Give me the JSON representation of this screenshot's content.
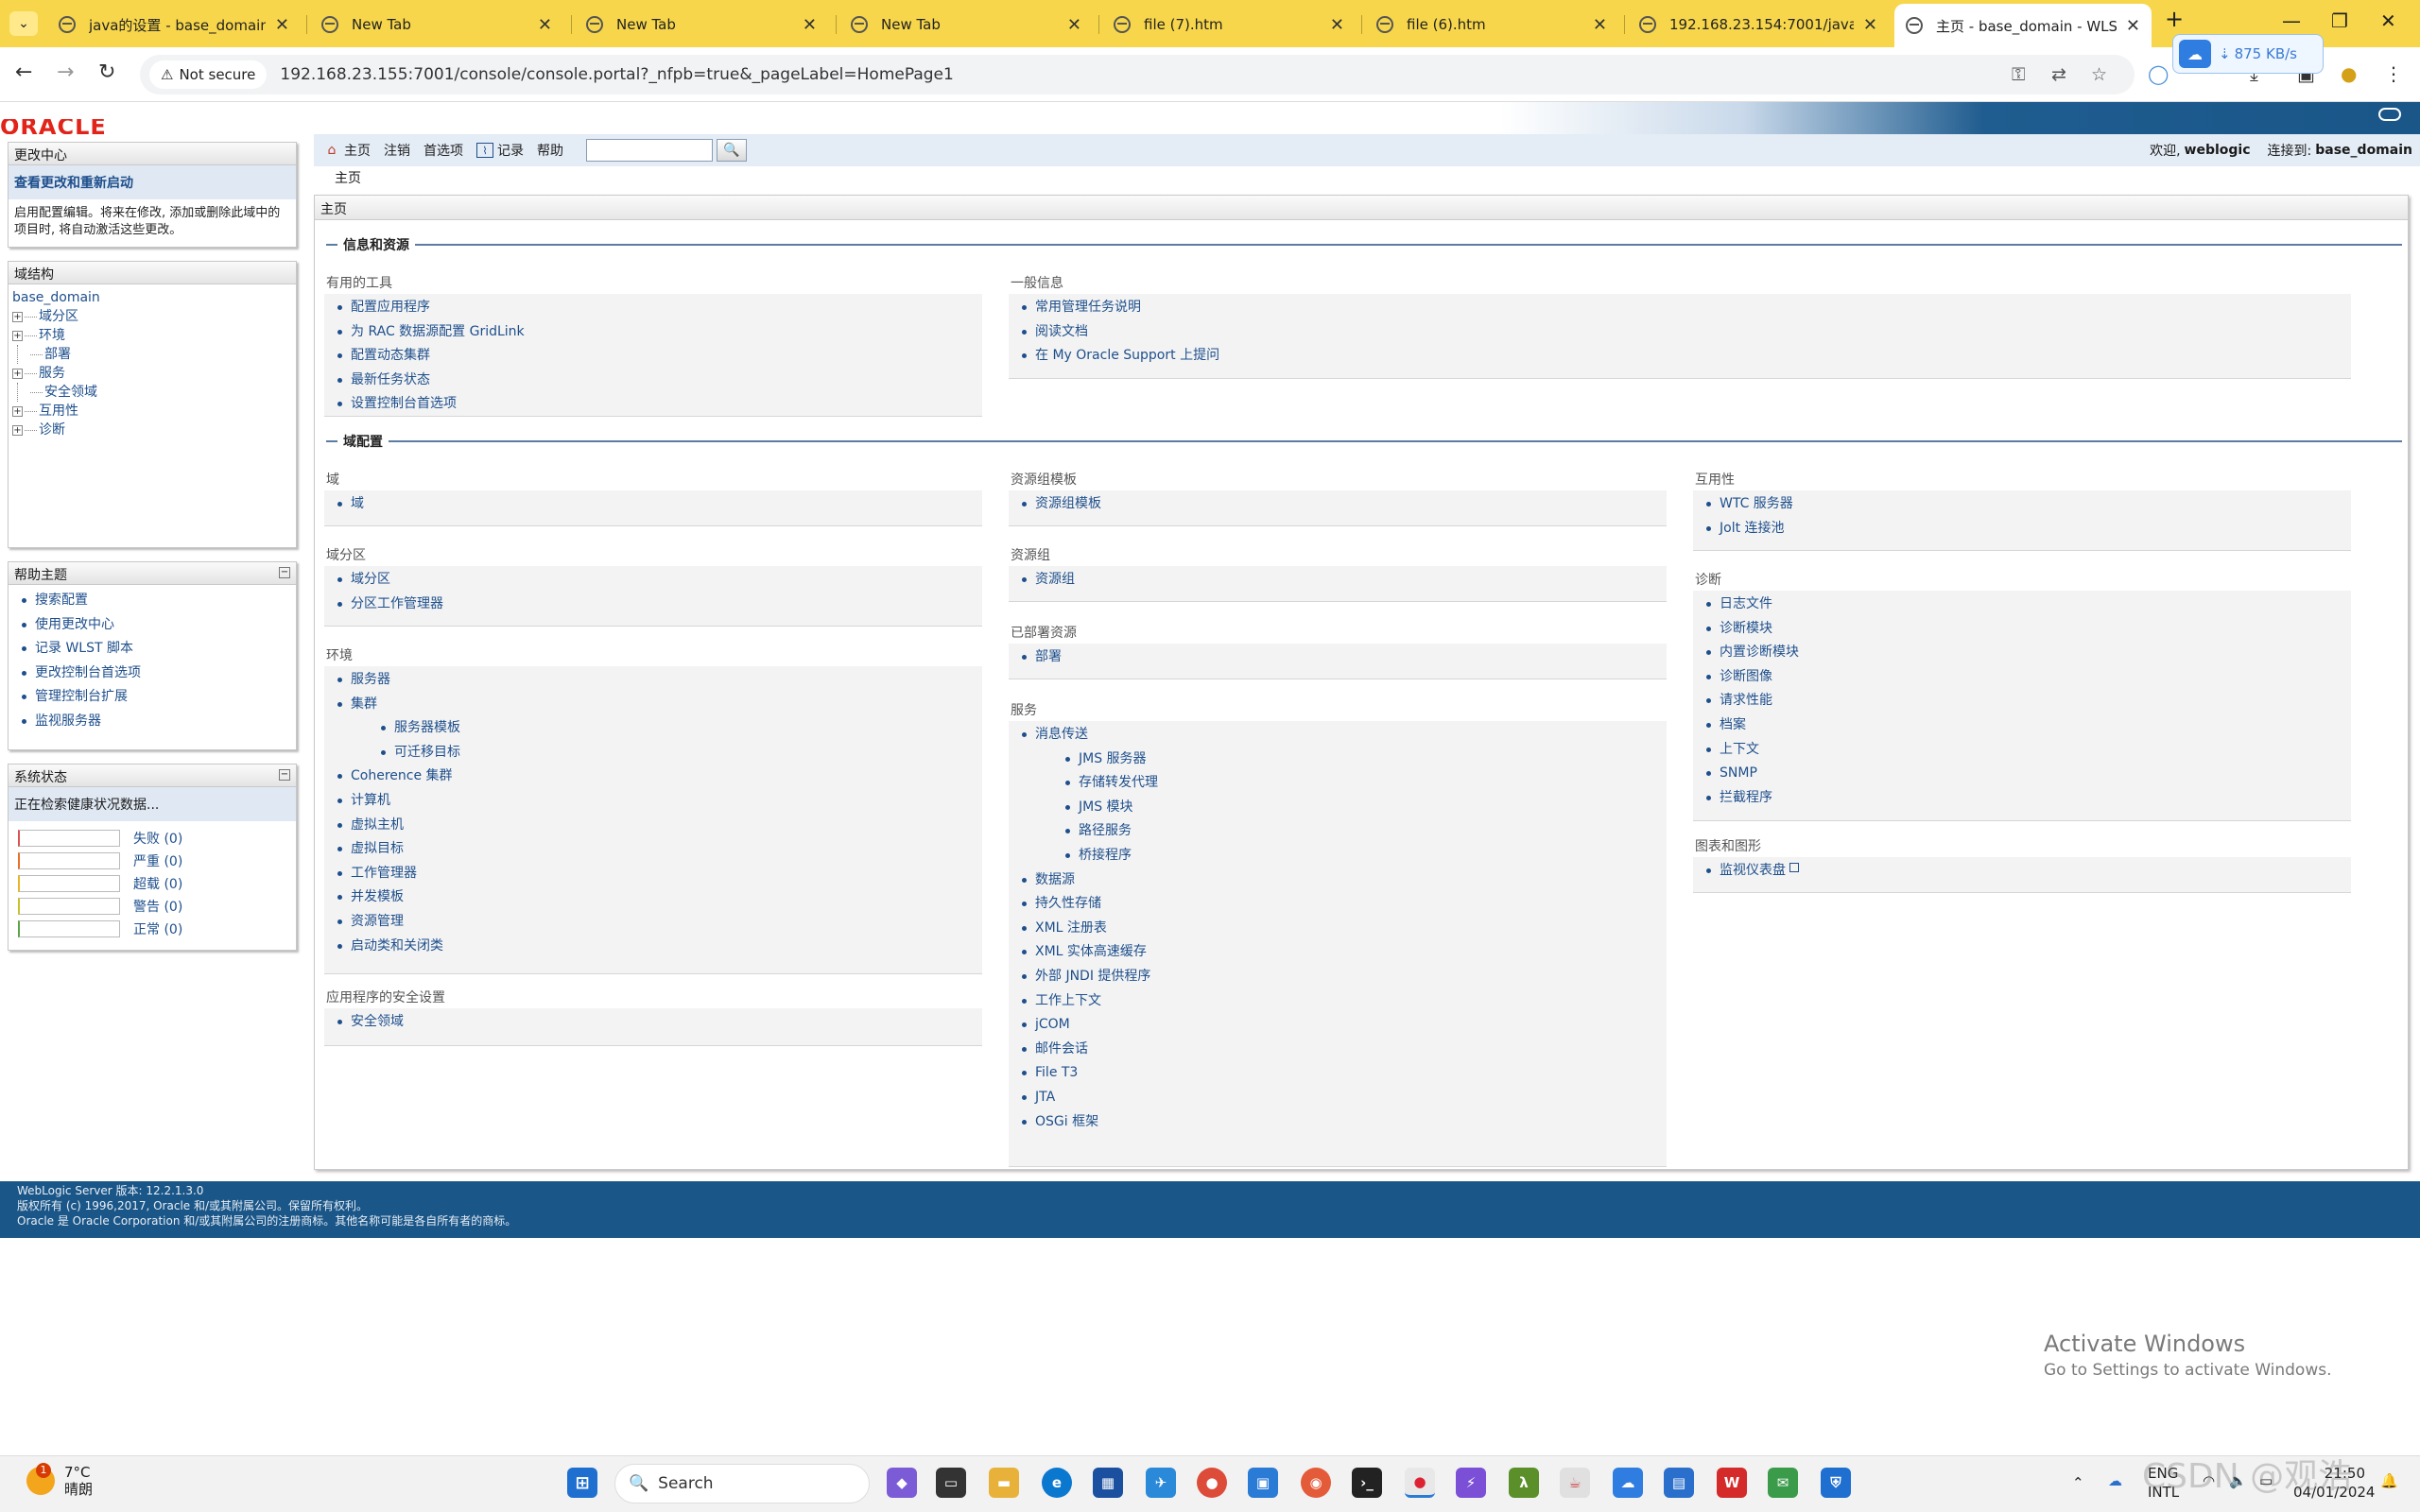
{
  "browser": {
    "tabs": [
      {
        "label": "java的设置 - base_domain - ",
        "active": false
      },
      {
        "label": "New Tab",
        "active": false
      },
      {
        "label": "New Tab",
        "active": false
      },
      {
        "label": "New Tab",
        "active": false
      },
      {
        "label": "file (7).htm",
        "active": false
      },
      {
        "label": "file (6).htm",
        "active": false
      },
      {
        "label": "192.168.23.154:7001/java",
        "active": false
      },
      {
        "label": "主页 - base_domain - WLS 控",
        "active": true
      }
    ],
    "new_tab": "+",
    "not_secure": "Not secure",
    "url": "192.168.23.155:7001/console/console.portal?_nfpb=true&_pageLabel=HomePage1",
    "download_speed": "875 KB/s"
  },
  "wls": {
    "logo": "ORACLE",
    "toolbar": {
      "home": "主页",
      "logout": "注销",
      "prefs": "首选项",
      "record": "记录",
      "help": "帮助"
    },
    "welcome": "欢迎,",
    "user": "weblogic",
    "connected": "连接到:",
    "domain": "base_domain",
    "breadcrumb": "主页",
    "panel_title": "主页"
  },
  "change_center": {
    "title": "更改中心",
    "link": "查看更改和重新启动",
    "text": "启用配置编辑。将来在修改, 添加或删除此域中的项目时, 将自动激活这些更改。"
  },
  "domain_structure": {
    "title": "域结构",
    "root": "base_domain",
    "items": [
      {
        "label": "域分区",
        "expandable": true
      },
      {
        "label": "环境",
        "expandable": true
      },
      {
        "label": "部署",
        "expandable": false
      },
      {
        "label": "服务",
        "expandable": true
      },
      {
        "label": "安全领域",
        "expandable": false
      },
      {
        "label": "互用性",
        "expandable": true
      },
      {
        "label": "诊断",
        "expandable": true
      }
    ]
  },
  "help_topics": {
    "title": "帮助主题",
    "items": [
      "搜索配置",
      "使用更改中心",
      "记录 WLST 脚本",
      "更改控制台首选项",
      "管理控制台扩展",
      "监视服务器"
    ]
  },
  "system_status": {
    "title": "系统状态",
    "message": "正在检索健康状况数据...",
    "rows": [
      {
        "label": "失败 (0)",
        "color": "#d9534f"
      },
      {
        "label": "严重 (0)",
        "color": "#e8702a"
      },
      {
        "label": "超载 (0)",
        "color": "#e8b52a"
      },
      {
        "label": "警告 (0)",
        "color": "#e8d62a"
      },
      {
        "label": "正常 (0)",
        "color": "#5aa544"
      }
    ]
  },
  "sections": {
    "info": "信息和资源",
    "domain_config": "域配置"
  },
  "groups": {
    "tools": {
      "title": "有用的工具",
      "items": [
        "配置应用程序",
        "为 RAC 数据源配置 GridLink",
        "配置动态集群",
        "最新任务状态",
        "设置控制台首选项"
      ]
    },
    "general": {
      "title": "一般信息",
      "items": [
        "常用管理任务说明",
        "阅读文档",
        "在 My Oracle Support 上提问"
      ]
    },
    "domain": {
      "title": "域",
      "items": [
        "域"
      ]
    },
    "partitions": {
      "title": "域分区",
      "items": [
        "域分区",
        "分区工作管理器"
      ]
    },
    "environment": {
      "title": "环境",
      "cluster": "集群",
      "cluster_sub": [
        "服务器模板",
        "可迁移目标"
      ],
      "servers": "服务器",
      "items": [
        "Coherence 集群",
        "计算机",
        "虚拟主机",
        "虚拟目标",
        "工作管理器",
        "并发模板",
        "资源管理",
        "启动类和关闭类"
      ]
    },
    "app_security": {
      "title": "应用程序的安全设置",
      "items": [
        "安全领域"
      ]
    },
    "rg_templates": {
      "title": "资源组模板",
      "items": [
        "资源组模板"
      ]
    },
    "resource_groups": {
      "title": "资源组",
      "items": [
        "资源组"
      ]
    },
    "deployed": {
      "title": "已部署资源",
      "items": [
        "部署"
      ]
    },
    "services": {
      "title": "服务",
      "messaging": "消息传送",
      "messaging_sub": [
        "JMS 服务器",
        "存储转发代理",
        "JMS 模块",
        "路径服务",
        "桥接程序"
      ],
      "items": [
        "数据源",
        "持久性存储",
        "XML 注册表",
        "XML 实体高速缓存",
        "外部 JNDI 提供程序",
        "工作上下文",
        "jCOM",
        "邮件会话",
        "File T3",
        "JTA",
        "OSGi 框架"
      ]
    },
    "interop": {
      "title": "互用性",
      "items": [
        "WTC 服务器",
        "Jolt 连接池"
      ]
    },
    "diagnostics": {
      "title": "诊断",
      "items": [
        "日志文件",
        "诊断模块",
        "内置诊断模块",
        "诊断图像",
        "请求性能",
        "档案",
        "上下文",
        "SNMP",
        "拦截程序"
      ]
    },
    "charts": {
      "title": "图表和图形",
      "items": [
        "监视仪表盘"
      ]
    }
  },
  "footer": {
    "line1": "WebLogic Server 版本: 12.2.1.3.0",
    "line2": "版权所有 (c) 1996,2017, Oracle 和/或其附属公司。保留所有权利。",
    "line3": "Oracle 是 Oracle Corporation 和/或其附属公司的注册商标。其他名称可能是各自所有者的商标。"
  },
  "activate_windows": {
    "line1": "Activate Windows",
    "line2": "Go to Settings to activate Windows."
  },
  "taskbar": {
    "temp": "7°C",
    "weather": "晴朗",
    "weather_badge": "1",
    "search": "Search",
    "lang1": "ENG",
    "lang2": "INTL",
    "time": "21:50",
    "date": "04/01/2024",
    "watermark": "CSDN @观浩"
  }
}
